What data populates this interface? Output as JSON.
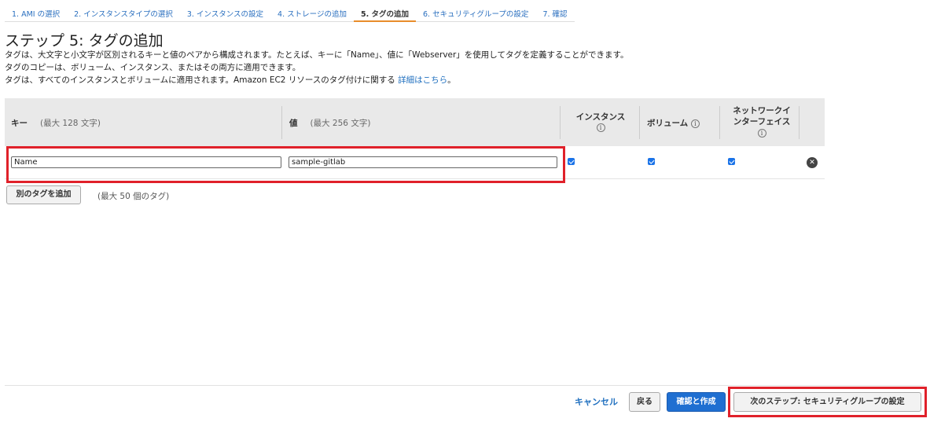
{
  "wizard": {
    "tabs": [
      {
        "label": "1. AMI の選択"
      },
      {
        "label": "2. インスタンスタイプの選択"
      },
      {
        "label": "3. インスタンスの設定"
      },
      {
        "label": "4. ストレージの追加"
      },
      {
        "label": "5. タグの追加"
      },
      {
        "label": "6. セキュリティグループの設定"
      },
      {
        "label": "7. 確認"
      }
    ],
    "active_tab_index": 4
  },
  "page": {
    "title": "ステップ 5: タグの追加",
    "desc1": "タグは、大文字と小文字が区別されるキーと値のペアから構成されます。たとえば、キーに「Name」、値に「Webserver」を使用してタグを定義することができます。",
    "desc2": "タグのコピーは、ボリューム、インスタンス、またはその両方に適用できます。",
    "desc3": "タグは、すべてのインスタンスとボリュームに適用されます。Amazon EC2 リソースのタグ付けに関する",
    "desc3_link": "詳細はこちら",
    "desc3_end": "。"
  },
  "table": {
    "key_header": "キー",
    "key_hint": "(最大 128 文字)",
    "value_header": "値",
    "value_hint": "(最大 256 文字)",
    "instance_header": "インスタンス",
    "volume_header": "ボリューム",
    "eni_header_line1": "ネットワークイ",
    "eni_header_line2": "ンターフェイス",
    "info_glyph": "i",
    "rows": [
      {
        "key": "Name",
        "value": "sample-gitlab",
        "instance": true,
        "volume": true,
        "eni": true
      }
    ],
    "remove_glyph": "✕"
  },
  "add_tag": {
    "button_label": "別のタグを追加",
    "limit_note": "(最大 50 個のタグ)"
  },
  "footer": {
    "cancel": "キャンセル",
    "back": "戻る",
    "review_launch": "確認と作成",
    "next": "次のステップ: セキュリティグループの設定"
  },
  "colors": {
    "highlight": "#e0212a",
    "primary": "#1f6fd1",
    "active_tab": "#e98d2b",
    "link": "#1f6fbf"
  }
}
